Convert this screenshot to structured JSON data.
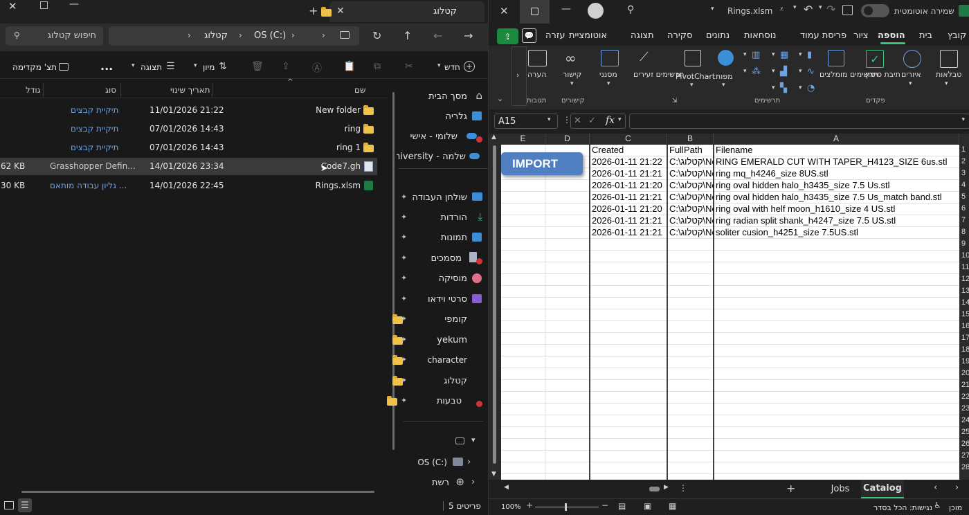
{
  "explorer": {
    "tab_title": "קטלוג",
    "breadcrumb": [
      "OS (C:)",
      "קטלוג"
    ],
    "search_placeholder": "חיפוש קטלוג",
    "toolbar": {
      "new_label": "חדש",
      "sort_label": "מיון",
      "view_label": "תצוגה",
      "preview_label": "תצ' מקדימה",
      "more_label": "..."
    },
    "columns": {
      "name": "שם",
      "modified": "תאריך שינוי",
      "type": "סוג",
      "size": "גודל"
    },
    "files": [
      {
        "name": "New folder",
        "modified": "11/01/2026 21:22",
        "type": "תיקיית קבצים",
        "size": "",
        "icon": "folder-icon"
      },
      {
        "name": "ring",
        "modified": "07/01/2026 14:43",
        "type": "תיקיית קבצים",
        "size": "",
        "icon": "folder-icon"
      },
      {
        "name": "ring 1",
        "modified": "07/01/2026 14:43",
        "type": "תיקיית קבצים",
        "size": "",
        "icon": "folder-icon"
      },
      {
        "name": "Code7.gh",
        "modified": "14/01/2026 23:34",
        "type": "Grasshopper Defin...",
        "size": "62 KB",
        "icon": "gh-file-icon",
        "selected": true
      },
      {
        "name": "Rings.xlsm",
        "modified": "14/01/2026 22:45",
        "type": "גליון עבודה מותאם ...",
        "size": "30 KB",
        "icon": "excel-file-icon"
      }
    ],
    "nav": [
      {
        "label": "מסך הבית",
        "icon": "home-icon"
      },
      {
        "label": "גלריה",
        "icon": "gallery-icon"
      },
      {
        "label": "שלומי - אישי",
        "icon": "cloud-icon"
      },
      {
        "label": "שלמה - University",
        "icon": "cloud-icon"
      },
      {
        "label": "שולחן העבודה",
        "icon": "desktop-icon"
      },
      {
        "label": "הורדות",
        "icon": "download-icon"
      },
      {
        "label": "תמונות",
        "icon": "pictures-icon"
      },
      {
        "label": "מסמכים",
        "icon": "documents-icon"
      },
      {
        "label": "מוסיקה",
        "icon": "music-icon"
      },
      {
        "label": "סרטי וידאו",
        "icon": "video-icon"
      },
      {
        "label": "קומפי",
        "icon": "folder-icon"
      },
      {
        "label": "yekum",
        "icon": "folder-icon"
      },
      {
        "label": "character",
        "icon": "folder-icon"
      },
      {
        "label": "קטלוג",
        "icon": "folder-icon"
      },
      {
        "label": "טבעות",
        "icon": "folder-icon"
      },
      {
        "label": "OS (C:)",
        "icon": "drive-icon"
      },
      {
        "label": "רשת",
        "icon": "network-icon"
      }
    ],
    "status": "5 פריטים"
  },
  "excel": {
    "title": "Rings.xlsm",
    "autosave_label": "שמירה אוטומטית",
    "menu": [
      "קובץ",
      "בית",
      "הוספה",
      "ציור",
      "פריסת עמוד",
      "נוסחאות",
      "נתונים",
      "סקירה",
      "תצוגה",
      "אוטומציית",
      "עזרה"
    ],
    "active_menu": "הוספה",
    "ribbon": {
      "tables": "טבלאות",
      "illustrations": "איורים",
      "checkbox": "תיבת סימון",
      "recommended_charts": "תרשימים מומלצים",
      "maps": "מפות",
      "pivotchart": "PivotChart",
      "sparklines": "תרשימים זעירים",
      "filters": "מסנני",
      "link": "קישור",
      "comment": "הערה",
      "group_controls": "פקדים",
      "group_charts": "תרשימים",
      "group_links": "קישורים",
      "group_comments": "תגובות"
    },
    "name_box": "A15",
    "fx": "fx",
    "columns": [
      "A",
      "B",
      "C",
      "D",
      "E"
    ],
    "headers": {
      "filename": "Filename",
      "fullpath": "FullPath",
      "created": "Created"
    },
    "rows": [
      {
        "filename": "RING EMERALD CUT WITH TAPER_H4123_SIZE 6us.stl",
        "fullpath": "C:\\קטלוג\\Ne",
        "created": "2026-01-11 21:22"
      },
      {
        "filename": "ring mq_h4246_size 8US.stl",
        "fullpath": "C:\\קטלוג\\Ne",
        "created": "2026-01-11 21:21"
      },
      {
        "filename": "ring oval hidden halo_h3435_size 7.5 Us.stl",
        "fullpath": "C:\\קטלוג\\Ne",
        "created": "2026-01-11 21:20"
      },
      {
        "filename": "ring oval hidden halo_h3435_size 7.5 Us_match band.stl",
        "fullpath": "C:\\קטלוג\\Ne",
        "created": "2026-01-11 21:21"
      },
      {
        "filename": "ring oval with helf moon_h1610_size 4 US.stl",
        "fullpath": "C:\\קטלוג\\Ne",
        "created": "2026-01-11 21:20"
      },
      {
        "filename": "ring radian split shank_h4247_size 7.5 US.stl",
        "fullpath": "C:\\קטלוג\\Ne",
        "created": "2026-01-11 21:21"
      },
      {
        "filename": "soliter cusion_h4251_size 7.5US.stl",
        "fullpath": "C:\\קטלוג\\Ne",
        "created": "2026-01-11 21:21"
      }
    ],
    "row_numbers": [
      "1",
      "2",
      "3",
      "4",
      "5",
      "6",
      "7",
      "8",
      "9",
      "10",
      "11",
      "12",
      "13",
      "14",
      "15",
      "16",
      "17",
      "18",
      "19",
      "20",
      "21",
      "22",
      "23",
      "24",
      "25",
      "26",
      "27",
      "28"
    ],
    "import_button": "IMPORT",
    "sheets": [
      "Catalog",
      "Jobs"
    ],
    "active_sheet": "Catalog",
    "status_ready": "מוכן",
    "status_access": "נגישות: הכל בסדר",
    "zoom": "100%"
  }
}
